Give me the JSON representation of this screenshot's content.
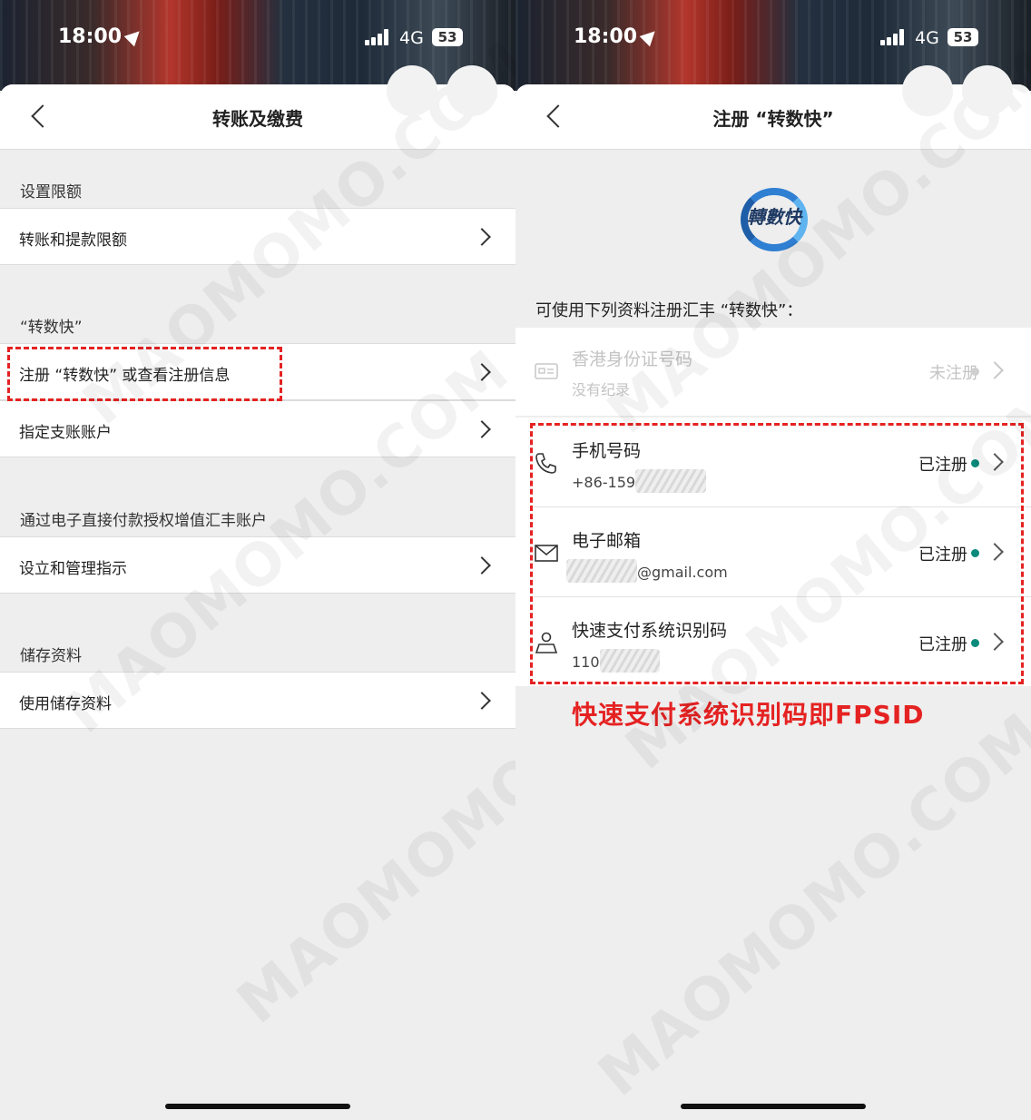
{
  "status_bar": {
    "time": "18:00",
    "network": "4G",
    "battery": "53"
  },
  "left": {
    "title": "转账及缴费",
    "sections": [
      {
        "heading": "设置限额",
        "rows": [
          "转账和提款限额"
        ]
      },
      {
        "heading": "“转数快”",
        "rows": [
          "注册 “转数快” 或查看注册信息",
          "指定支账账户"
        ]
      },
      {
        "heading": "通过电子直接付款授权增值汇丰账户",
        "rows": [
          "设立和管理指示"
        ]
      },
      {
        "heading": "储存资料",
        "rows": [
          "使用储存资料"
        ]
      }
    ]
  },
  "right": {
    "title": "注册 “转数快”",
    "logo_text": "轉數快",
    "intro": "可使用下列资料注册汇丰 “转数快”：",
    "items": [
      {
        "title": "香港身份证号码",
        "subtitle": "没有纪录",
        "status": "未注册",
        "icon": "id-card-icon",
        "enabled": false
      },
      {
        "title": "手机号码",
        "subtitle": "+86-159",
        "status": "已注册",
        "icon": "phone-icon",
        "enabled": true
      },
      {
        "title": "电子邮箱",
        "subtitle": "@gmail.com",
        "status": "已注册",
        "icon": "mail-icon",
        "enabled": true
      },
      {
        "title": "快速支付系统识别码",
        "subtitle": "110",
        "status": "已注册",
        "icon": "person-icon",
        "enabled": true
      }
    ],
    "caption": "快速支付系统识别码即FPSID"
  },
  "watermark": "MAOMOMO.COM",
  "colors": {
    "accent_red": "#e52222",
    "status_green": "#0a8a7a"
  }
}
